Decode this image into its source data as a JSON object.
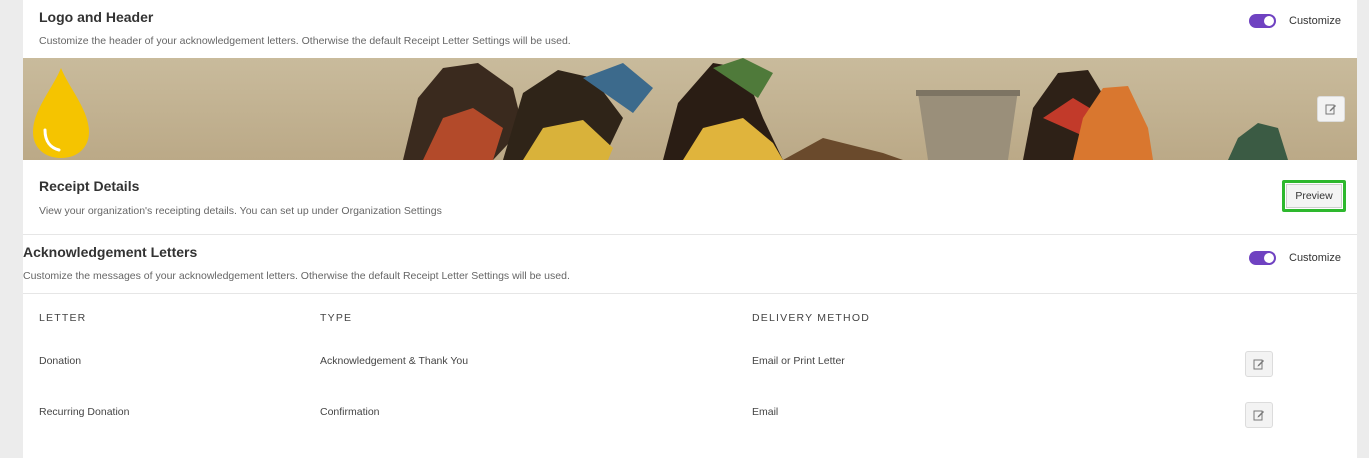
{
  "logo_header": {
    "title": "Logo and Header",
    "description": "Customize the header of your acknowledgement letters. Otherwise the default Receipt Letter Settings will be used.",
    "toggle_label": "Customize",
    "toggle_on": true
  },
  "receipt_details": {
    "title": "Receipt Details",
    "description": "View your organization's receipting details. You can set up under Organization Settings",
    "preview_label": "Preview"
  },
  "ack_letters": {
    "title": "Acknowledgement Letters",
    "description": "Customize the messages of your acknowledgement letters. Otherwise the default Receipt Letter Settings will be used.",
    "toggle_label": "Customize",
    "toggle_on": true,
    "columns": [
      "LETTER",
      "TYPE",
      "DELIVERY METHOD"
    ],
    "rows": [
      {
        "letter": "Donation",
        "type": "Acknowledgement & Thank You",
        "delivery": "Email or Print Letter"
      },
      {
        "letter": "Recurring Donation",
        "type": "Confirmation",
        "delivery": "Email"
      }
    ]
  },
  "colors": {
    "accent": "#6f42c1",
    "highlight": "#2eb82e",
    "logo": "#f5c400"
  },
  "icons": {
    "logo": "water-drop-icon",
    "edit": "edit-icon"
  }
}
